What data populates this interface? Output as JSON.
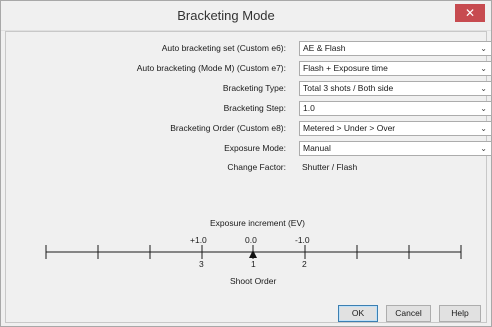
{
  "window": {
    "title": "Bracketing Mode",
    "close_glyph": "✕"
  },
  "form": {
    "rows": [
      {
        "label": "Auto bracketing set (Custom e6):",
        "value": "AE & Flash"
      },
      {
        "label": "Auto bracketing (Mode M) (Custom e7):",
        "value": "Flash + Exposure time"
      },
      {
        "label": "Bracketing Type:",
        "value": "Total 3 shots / Both side"
      },
      {
        "label": "Bracketing Step:",
        "value": "1.0"
      },
      {
        "label": "Bracketing Order (Custom e8):",
        "value": "Metered > Under > Over"
      },
      {
        "label": "Exposure Mode:",
        "value": "Manual"
      }
    ],
    "change_factor": {
      "label": "Change Factor:",
      "value": "Shutter / Flash"
    },
    "dropdown_arrow": "⌄"
  },
  "scale": {
    "exposure_caption": "Exposure increment (EV)",
    "ev_labels": [
      "+1.0",
      "0.0",
      "-1.0"
    ],
    "order_labels": [
      "3",
      "1",
      "2"
    ],
    "shoot_order_caption": "Shoot Order"
  },
  "buttons": {
    "ok": "OK",
    "cancel": "Cancel",
    "help": "Help"
  },
  "colors": {
    "close_button": "#c74b50",
    "default_button_border": "#3c7fb1"
  }
}
